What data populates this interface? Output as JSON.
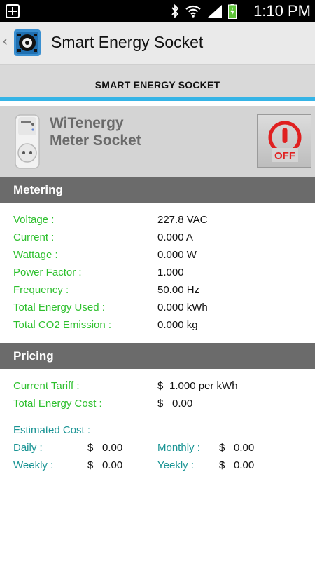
{
  "status_bar": {
    "time": "1:10 PM",
    "icons": [
      "notification-plus-icon",
      "bluetooth-icon",
      "wifi-icon",
      "signal-icon",
      "battery-icon"
    ]
  },
  "action_bar": {
    "back": "‹",
    "title": "Smart Energy Socket"
  },
  "tab": {
    "label": "SMART ENERGY SOCKET",
    "accent": "#35b4e6"
  },
  "device": {
    "name_line1": "WiTenergy",
    "name_line2": "Meter Socket",
    "power_state": "OFF"
  },
  "metering": {
    "title": "Metering",
    "rows": [
      {
        "label": "Voltage :",
        "value": "227.8 VAC"
      },
      {
        "label": "Current :",
        "value": "0.000 A"
      },
      {
        "label": "Wattage :",
        "value": "0.000 W"
      },
      {
        "label": "Power Factor :",
        "value": "1.000"
      },
      {
        "label": "Frequency :",
        "value": "50.00 Hz"
      },
      {
        "label": "Total Energy Used :",
        "value": "0.000 kWh"
      },
      {
        "label": "Total CO2 Emission :",
        "value": "0.000 kg"
      }
    ]
  },
  "pricing": {
    "title": "Pricing",
    "tariff_label": "Current Tariff :",
    "tariff_currency": "$",
    "tariff_value": "1.000 per kWh",
    "cost_label": "Total Energy Cost :",
    "cost_currency": "$",
    "cost_value": "0.00",
    "estimated_label": "Estimated Cost :",
    "daily_label": "Daily :",
    "daily_currency": "$",
    "daily_value": "0.00",
    "monthly_label": "Monthly :",
    "monthly_currency": "$",
    "monthly_value": "0.00",
    "weekly_label": "Weekly :",
    "weekly_currency": "$",
    "weekly_value": "0.00",
    "yearly_label": "Yeekly :",
    "yearly_currency": "$",
    "yearly_value": "0.00"
  },
  "colors": {
    "label_green": "#2ec02e",
    "label_teal": "#1a9494",
    "header_gray": "#6b6b6b"
  }
}
